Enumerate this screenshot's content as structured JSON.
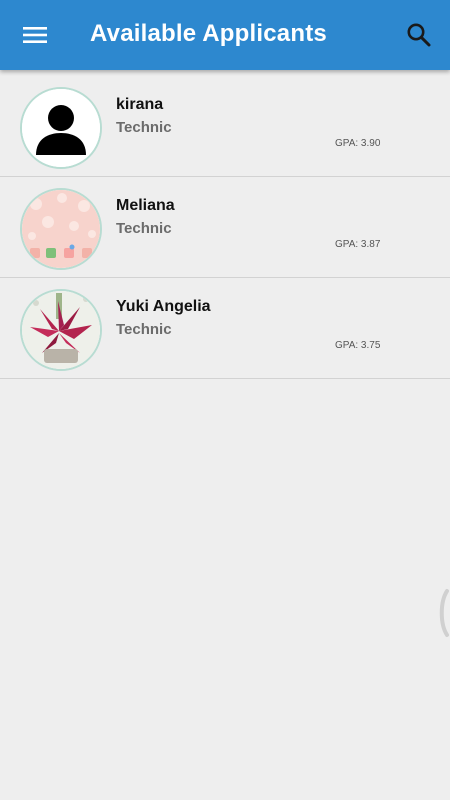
{
  "appbar": {
    "title": "Available Applicants",
    "menu_icon": "hamburger-menu-icon",
    "search_icon": "search-icon",
    "background_color": "#2d88cf"
  },
  "applicants": [
    {
      "name": "kirana",
      "major": "Technic",
      "gpa": "GPA: 3.90",
      "avatar": "default-person-icon"
    },
    {
      "name": "Meliana",
      "major": "Technic",
      "gpa": "GPA: 3.87",
      "avatar": "pink-pattern-photo"
    },
    {
      "name": "Yuki Angelia",
      "major": "Technic",
      "gpa": "GPA: 3.75",
      "avatar": "red-flower-plant-photo"
    }
  ]
}
